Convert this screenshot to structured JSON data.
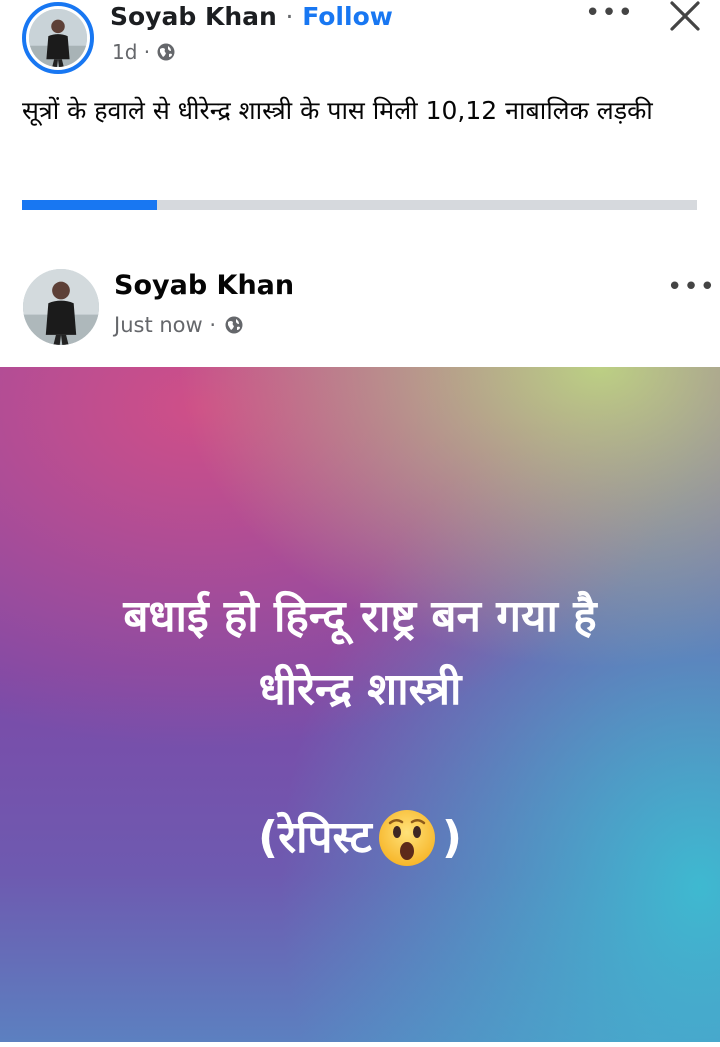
{
  "story": {
    "author": "Soyab Khan",
    "separator": "·",
    "follow_label": "Follow",
    "time": "1d ·",
    "text": "सूत्रों के हवाले से धीरेन्द्र शास्त्री के पास मिली 10,12 नाबालिक लड़की",
    "progress_fraction": 0.2,
    "icons": [
      "avatar",
      "globe-icon",
      "more-options-icon",
      "close-icon"
    ]
  },
  "post": {
    "author": "Soyab Khan",
    "time": "Just now ·",
    "line1": "बधाई हो हिन्दू राष्ट्र बन गया है",
    "line2": "धीरेन्द्र शास्त्री",
    "line3_prefix": "(रेपिस्ट",
    "line3_suffix": ")",
    "emoji": "surprised-face-emoji"
  },
  "colors": {
    "accent": "#1877f2",
    "muted_text": "#65676b",
    "progress_track": "#d6d9dd"
  }
}
